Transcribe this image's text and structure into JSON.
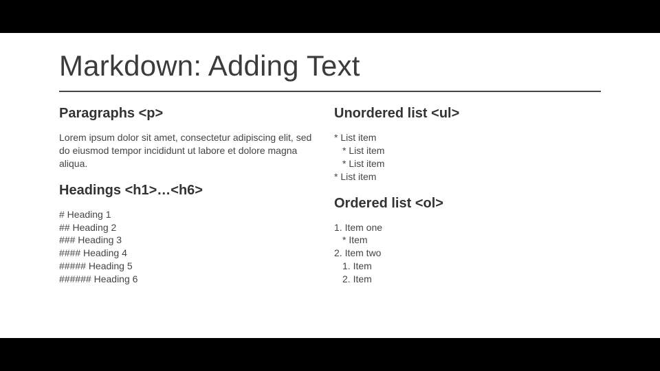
{
  "title": "Markdown: Adding Text",
  "left": {
    "paragraphs": {
      "heading": "Paragraphs <p>",
      "body": "Lorem ipsum dolor sit amet, consectetur adipiscing elit, sed do eiusmod tempor incididunt ut labore et dolore magna aliqua."
    },
    "headings": {
      "heading": "Headings <h1>…<h6>",
      "lines": [
        "# Heading 1",
        "## Heading 2",
        "### Heading 3",
        "#### Heading 4",
        "##### Heading 5",
        "###### Heading 6"
      ]
    }
  },
  "right": {
    "unordered": {
      "heading": "Unordered list <ul>",
      "lines": [
        "* List item",
        "* List item",
        "* List item",
        "* List item"
      ]
    },
    "ordered": {
      "heading": "Ordered list <ol>",
      "lines": [
        "1. Item one",
        "* Item",
        "2. Item two",
        "1. Item",
        "2. Item"
      ]
    }
  }
}
